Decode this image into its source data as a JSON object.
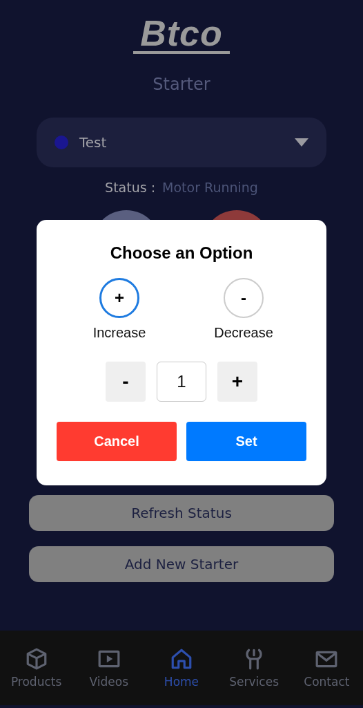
{
  "logo": {
    "text": "Btco"
  },
  "title": "Starter",
  "dropdown": {
    "value": "Test"
  },
  "status": {
    "label": "Status :",
    "value": "Motor Running"
  },
  "action_buttons": [
    "Refresh Status",
    "Add New Starter"
  ],
  "dialog": {
    "title": "Choose an Option",
    "options": [
      {
        "symbol": "+",
        "label": "Increase",
        "selected": true
      },
      {
        "symbol": "-",
        "label": "Decrease",
        "selected": false
      }
    ],
    "stepper": {
      "decrement": "-",
      "value": "1",
      "increment": "+"
    },
    "buttons": [
      {
        "label": "Cancel",
        "kind": "cancel"
      },
      {
        "label": "Set",
        "kind": "confirm"
      }
    ]
  },
  "nav": [
    {
      "label": "Products",
      "kind": "box",
      "selected": false
    },
    {
      "label": "Videos",
      "kind": "play",
      "selected": false
    },
    {
      "label": "Home",
      "kind": "home",
      "selected": true
    },
    {
      "label": "Services",
      "kind": "wrench",
      "selected": false
    },
    {
      "label": "Contact",
      "kind": "mail",
      "selected": false
    }
  ]
}
